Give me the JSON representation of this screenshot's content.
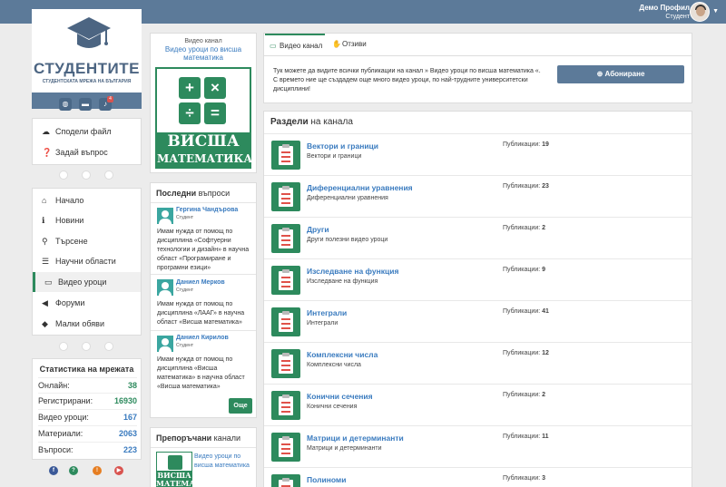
{
  "topbar": {
    "profile_name": "Демо Профил",
    "profile_role": "Студент"
  },
  "logo": {
    "title": "СТУДЕНТИТЕ",
    "subtitle": "СТУДЕНТСКАТА МРЕЖА НА БЪЛГАРИЯ",
    "notification_count": "4"
  },
  "actions": [
    {
      "icon": "cloud-upload-icon",
      "label": "Сподели файл"
    },
    {
      "icon": "question-icon",
      "label": "Задай въпрос"
    }
  ],
  "nav": [
    {
      "icon": "home-icon",
      "label": "Начало",
      "active": false
    },
    {
      "icon": "info-icon",
      "label": "Новини",
      "active": false
    },
    {
      "icon": "search-icon",
      "label": "Търсене",
      "active": false
    },
    {
      "icon": "list-icon",
      "label": "Научни области",
      "active": false
    },
    {
      "icon": "monitor-icon",
      "label": "Видео уроци",
      "active": true
    },
    {
      "icon": "megaphone-icon",
      "label": "Форуми",
      "active": false
    },
    {
      "icon": "tag-icon",
      "label": "Малки обяви",
      "active": false
    }
  ],
  "stats": {
    "title": "Статистика на мрежата",
    "rows": [
      {
        "label": "Онлайн:",
        "value": "38",
        "color": "#2d8a5d"
      },
      {
        "label": "Регистрирани:",
        "value": "16930",
        "color": "#2d8a5d"
      },
      {
        "label": "Видео уроци:",
        "value": "167",
        "color": "#3a7bbf"
      },
      {
        "label": "Материали:",
        "value": "2063",
        "color": "#3a7bbf"
      },
      {
        "label": "Въпроси:",
        "value": "223",
        "color": "#3a7bbf"
      }
    ]
  },
  "social": [
    {
      "icon": "facebook-icon",
      "glyph": "f",
      "color": "#3b5998"
    },
    {
      "icon": "help-icon",
      "glyph": "?",
      "color": "#2d8a5d"
    },
    {
      "icon": "info-circle-icon",
      "glyph": "!",
      "color": "#e67e22"
    },
    {
      "icon": "youtube-icon",
      "glyph": "▶",
      "color": "#d9534f"
    }
  ],
  "channel": {
    "kicker": "Видео канал",
    "name": "Видео уроци по висша математика",
    "image_word1": "ВИСША",
    "image_word2": "МАТЕМАТИКА"
  },
  "questions": {
    "title_bold": "Последни",
    "title_rest": " въпроси",
    "items": [
      {
        "name": "Гергина Чандърова",
        "role": "Студент",
        "text": "Имам нужда от помощ по дисциплина «Софтуерни технологии и дизайн» в научна област «Програмиране и програмни езици»"
      },
      {
        "name": "Даниел Мерков",
        "role": "Студент",
        "text": "Имам нужда от помощ по дисциплина «ЛААГ» в научна област «Висша математика»"
      },
      {
        "name": "Даниел Кирилов",
        "role": "Студент",
        "text": "Имам нужда от помощ по дисциплина «Висша математика» в научна област «Висша математика»"
      }
    ],
    "more_label": "Още"
  },
  "recommended": {
    "title_bold": "Препоръчани",
    "title_rest": " канали",
    "name": "Видео уроци по висша математика",
    "image_word": "ВИСША МАТЕМАТИКА"
  },
  "tabs": [
    {
      "icon": "monitor-icon",
      "label": "Видео канал",
      "active": true
    },
    {
      "icon": "thumbs-up-icon",
      "label": "Отзиви",
      "active": false
    }
  ],
  "intro_text": "Тук можете да видите всички публикации на канал » Видео уроци по висша математика «. С времето ние ще създадем още много видео уроци, по най-трудните университетски дисциплини!",
  "subscribe_label": "Абониране",
  "sections": {
    "title_bold": "Раздели",
    "title_rest": " на канала",
    "count_label": "Публикации:",
    "items": [
      {
        "name": "Вектори и граници",
        "desc": "Вектори и граници",
        "count": "19"
      },
      {
        "name": "Диференциални уравнения",
        "desc": "Диференциални уравнения",
        "count": "23"
      },
      {
        "name": "Други",
        "desc": "Други полезни видео уроци",
        "count": "2"
      },
      {
        "name": "Изследване на функция",
        "desc": "Изследване на функция",
        "count": "9"
      },
      {
        "name": "Интеграли",
        "desc": "Интеграли",
        "count": "41"
      },
      {
        "name": "Комплексни числа",
        "desc": "Комплексни числа",
        "count": "12"
      },
      {
        "name": "Конични сечения",
        "desc": "Конични сечения",
        "count": "2"
      },
      {
        "name": "Матрици и детерминанти",
        "desc": "Матрици и детерминанти",
        "count": "11"
      },
      {
        "name": "Полиноми",
        "desc": "",
        "count": "3"
      }
    ]
  }
}
